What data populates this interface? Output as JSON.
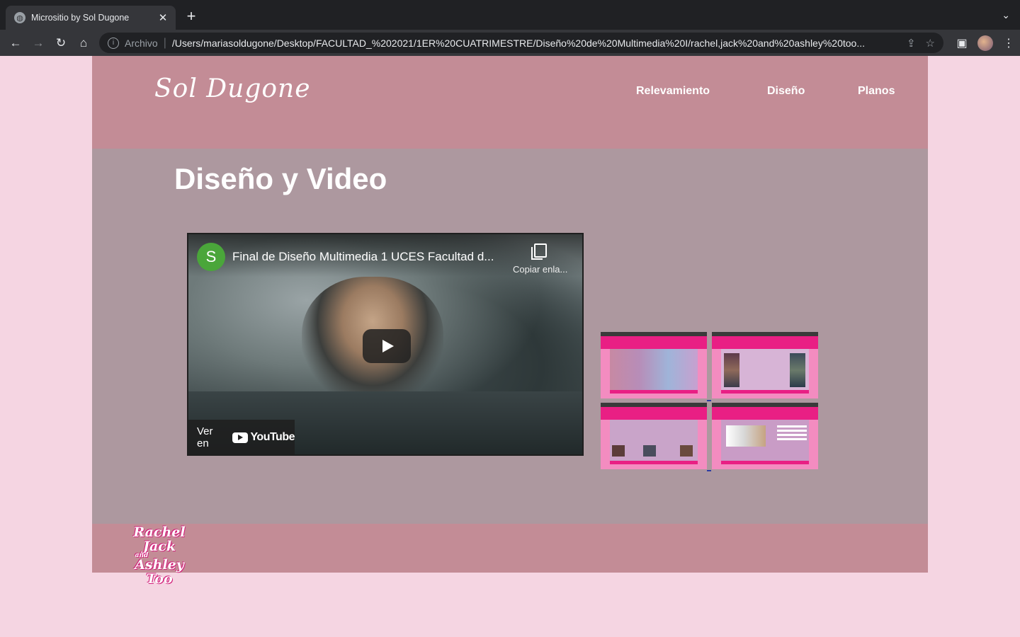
{
  "browser": {
    "tab_title": "Micrositio by Sol Dugone",
    "tab_close": "✕",
    "new_tab": "+",
    "tabs_menu": "⌄",
    "scheme_label": "Archivo",
    "url": "/Users/mariasoldugone/Desktop/FACULTAD_%202021/1ER%20CUATRIMESTRE/Diseño%20de%20Multimedia%20I/rachel,jack%20and%20ashley%20too..."
  },
  "site": {
    "logo": "Sol Dugone",
    "nav": [
      "Relevamiento",
      "Diseño",
      "Planos"
    ],
    "page_title": "Diseño y Video"
  },
  "video": {
    "channel_initial": "S",
    "title": "Final de Diseño Multimedia 1 UCES Facultad d...",
    "copy_label": "Copiar enla...",
    "watch_on": "Ver en",
    "youtube": "YouTube"
  },
  "footer": {
    "logo_line1": "Rachel Jack",
    "logo_and": "and",
    "logo_line2": "Ashley Too"
  },
  "colors": {
    "page_bg": "#f5d5e2",
    "header": "#c38c96",
    "content": "#ad989f",
    "thumb_pink": "#e91f84"
  }
}
